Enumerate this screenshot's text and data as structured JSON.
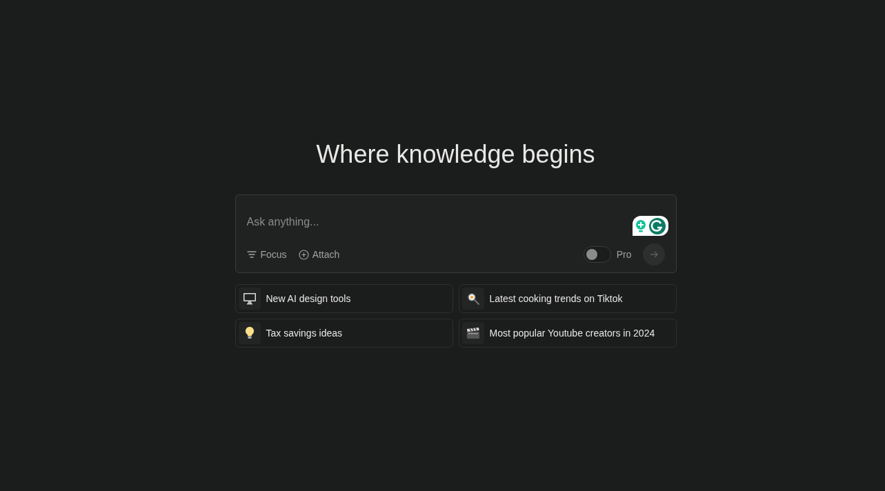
{
  "heading": "Where knowledge begins",
  "search": {
    "placeholder": "Ask anything...",
    "focus": "Focus",
    "attach": "Attach",
    "pro": {
      "label": "Pro",
      "on": false
    }
  },
  "suggestions": [
    {
      "kind": "computer",
      "label": "New AI design tools"
    },
    {
      "kind": "pan",
      "label": "Latest cooking trends on Tiktok"
    },
    {
      "kind": "bulb",
      "label": "Tax savings ideas"
    },
    {
      "kind": "clapper",
      "label": "Most popular Youtube creators in 2024"
    }
  ]
}
